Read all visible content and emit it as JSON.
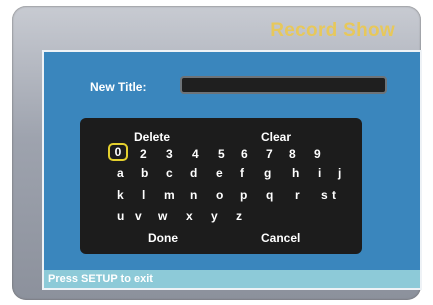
{
  "header": {
    "title": "Record Show"
  },
  "form": {
    "new_title_label": "New Title:",
    "new_title_value": ""
  },
  "keyboard": {
    "delete_label": "Delete",
    "clear_label": "Clear",
    "digits": [
      "0",
      "1",
      "2",
      "3",
      "4",
      "5",
      "6",
      "7",
      "8",
      "9"
    ],
    "row1": [
      "a",
      "b",
      "c",
      "d",
      "e",
      "f",
      "g",
      "h",
      "i",
      "j"
    ],
    "row2": [
      "k",
      "l",
      "m",
      "n",
      "o",
      "p",
      "q",
      "r",
      "s",
      "t"
    ],
    "row3": [
      "u",
      "v",
      "w",
      "x",
      "y",
      "z"
    ],
    "done_label": "Done",
    "cancel_label": "Cancel",
    "selected_key": "0"
  },
  "status": {
    "text": "Press SETUP to exit"
  },
  "colors": {
    "title": "#e7c85b",
    "panel": "#3a86bd",
    "keyboard": "#1c1c1c",
    "selection": "#e4d02e",
    "status_bar": "#8dcad8"
  }
}
